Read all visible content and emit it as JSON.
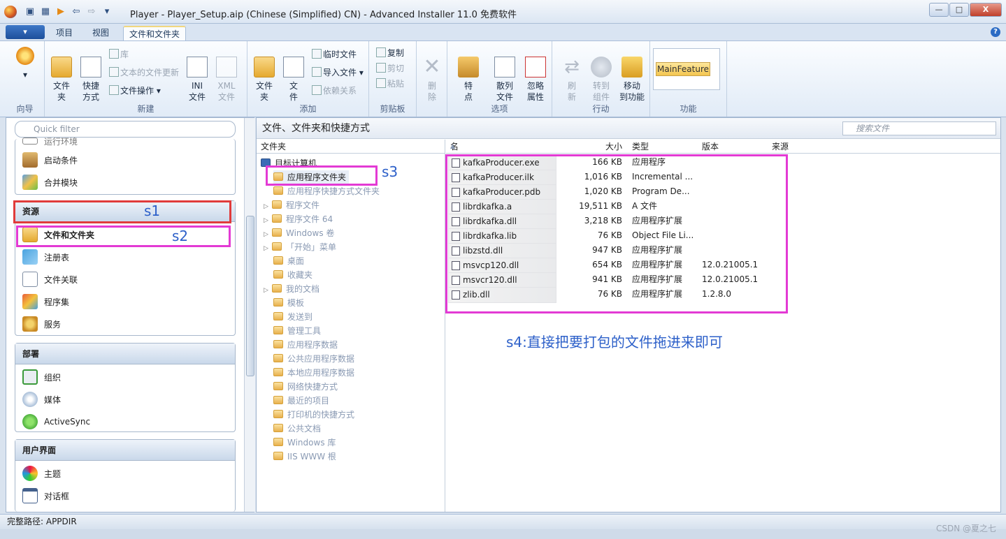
{
  "window": {
    "title": "Player - Player_Setup.aip (Chinese (Simplified) CN) - Advanced Installer 11.0 免费软件",
    "minimize": "—",
    "maximize": "□",
    "close": "X"
  },
  "tabs": {
    "app_button": "▾",
    "items": [
      "项目",
      "视图",
      "文件和文件夹"
    ],
    "help": "?"
  },
  "ribbon": {
    "wizard": {
      "label": "",
      "group": "向导"
    },
    "new": {
      "group": "新建",
      "folder": "文件\n夹",
      "shortcut": "快捷\n方式",
      "library": "库",
      "text_update": "文本的文件更新",
      "file_ops": "文件操作",
      "ini": "INI\n文件",
      "xml": "XML\n文件"
    },
    "add": {
      "group": "添加",
      "folder": "文件\n夹",
      "file": "文\n件",
      "temp_file": "临时文件",
      "import_file": "导入文件",
      "dependencies": "依赖关系"
    },
    "clipboard": {
      "group": "剪贴板",
      "copy": "复制",
      "cut": "剪切",
      "paste": "粘贴"
    },
    "delete": "删\n除",
    "options": {
      "group": "选项",
      "properties": "特\n点",
      "scatter": "散列\n文件",
      "ignore": "忽略\n属性"
    },
    "actions": {
      "group": "行动",
      "refresh": "刷\n新",
      "goto": "转到\n组件",
      "move": "移动\n到功能"
    },
    "features": {
      "group": "功能",
      "selected": "MainFeature"
    }
  },
  "left_panel": {
    "filter_placeholder": "Quick filter",
    "partial_item": "运行环境",
    "top_items": [
      "启动条件",
      "合并模块"
    ],
    "sections": [
      {
        "title": "资源",
        "items": [
          "文件和文件夹",
          "注册表",
          "文件关联",
          "程序集",
          "服务"
        ]
      },
      {
        "title": "部署",
        "items": [
          "组织",
          "媒体",
          "ActiveSync"
        ]
      },
      {
        "title": "用户界面",
        "items": [
          "主题",
          "对话框"
        ]
      }
    ]
  },
  "right_panel": {
    "title": "文件、文件夹和快捷方式",
    "search_placeholder": "搜索文件",
    "tree_header": "文件夹",
    "tree_root": "目标计算机",
    "tree_items": [
      "应用程序文件夹",
      "应用程序快捷方式文件夹",
      "程序文件",
      "程序文件 64",
      "Windows 卷",
      "「开始」菜单",
      "桌面",
      "收藏夹",
      "我的文档",
      "模板",
      "发送到",
      "管理工具",
      "应用程序数据",
      "公共应用程序数据",
      "本地应用程序数据",
      "网络快捷方式",
      "最近的项目",
      "打印机的快捷方式",
      "公共文档",
      "Windows 库",
      "IIS WWW 根"
    ],
    "columns": {
      "name": "名称",
      "size": "大小",
      "type": "类型",
      "version": "版本",
      "source": "来源"
    },
    "files": [
      {
        "name": "kafkaProducer.exe",
        "size": "166 KB",
        "type": "应用程序",
        "version": ""
      },
      {
        "name": "kafkaProducer.ilk",
        "size": "1,016 KB",
        "type": "Incremental ...",
        "version": ""
      },
      {
        "name": "kafkaProducer.pdb",
        "size": "1,020 KB",
        "type": "Program De...",
        "version": ""
      },
      {
        "name": "librdkafka.a",
        "size": "19,511 KB",
        "type": "A 文件",
        "version": ""
      },
      {
        "name": "librdkafka.dll",
        "size": "3,218 KB",
        "type": "应用程序扩展",
        "version": ""
      },
      {
        "name": "librdkafka.lib",
        "size": "76 KB",
        "type": "Object File Li...",
        "version": ""
      },
      {
        "name": "libzstd.dll",
        "size": "947 KB",
        "type": "应用程序扩展",
        "version": ""
      },
      {
        "name": "msvcp120.dll",
        "size": "654 KB",
        "type": "应用程序扩展",
        "version": "12.0.21005.1"
      },
      {
        "name": "msvcr120.dll",
        "size": "941 KB",
        "type": "应用程序扩展",
        "version": "12.0.21005.1"
      },
      {
        "name": "zlib.dll",
        "size": "76 KB",
        "type": "应用程序扩展",
        "version": "1.2.8.0"
      }
    ]
  },
  "annotations": {
    "s1": "s1",
    "s2": "s2",
    "s3": "s3",
    "s4": "s4:直接把要打包的文件拖进来即可",
    "color_pink": "#e33ad4",
    "color_red": "#e03b3b"
  },
  "status": {
    "path": "完整路径: APPDIR"
  },
  "watermark": "CSDN @夏之七"
}
